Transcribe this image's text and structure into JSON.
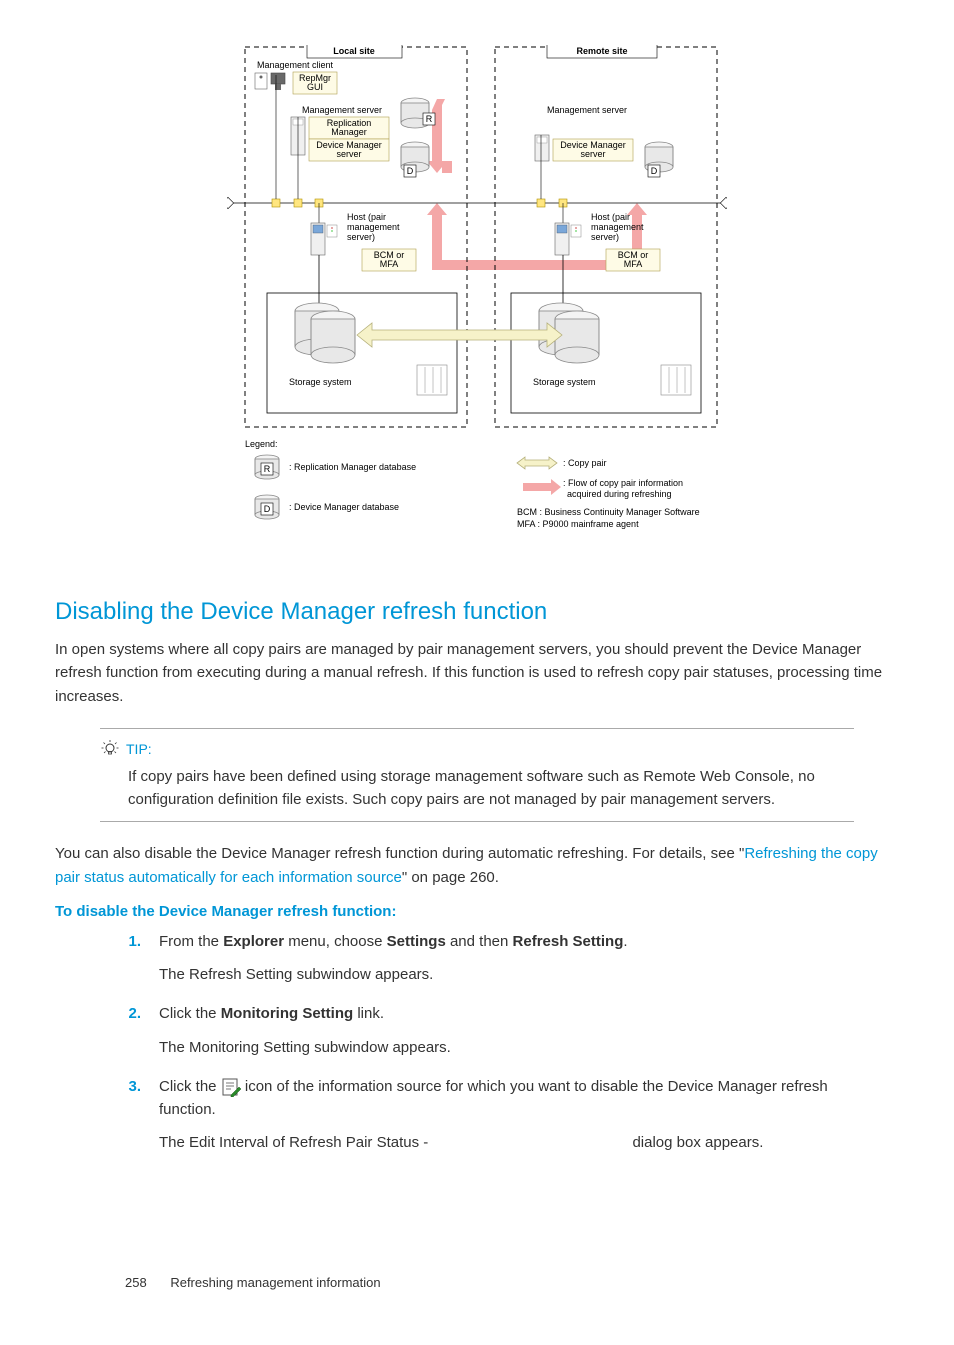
{
  "diagram": {
    "local_site": "Local site",
    "remote_site": "Remote site",
    "mgmt_client": "Management client",
    "repmgr_gui": "RepMgr GUI",
    "mgmt_server": "Management server",
    "replication_manager": "Replication Manager",
    "device_manager_server": "Device Manager server",
    "host_pair": "Host (pair management server)",
    "bcm_mfa": "BCM or MFA",
    "storage_system": "Storage system",
    "legend": "Legend:",
    "r_label": ": Replication Manager database",
    "d_label": ": Device Manager database",
    "copy_pair": ": Copy pair",
    "flow": ": Flow of copy pair information acquired during refreshing",
    "bcm_def": "BCM : Business Continuity Manager Software",
    "mfa_def": "MFA : P9000 mainframe agent",
    "r_badge": "R",
    "d_badge": "D"
  },
  "section": {
    "title": "Disabling the Device Manager refresh function",
    "intro": "In open systems where all copy pairs are managed by pair management servers, you should prevent the Device Manager refresh function from executing during a manual refresh. If this function is used to refresh copy pair statuses, processing time increases."
  },
  "tip": {
    "label": "TIP:",
    "body": "If copy pairs have been defined using storage management software such as Remote Web Console, no configuration definition file exists. Such copy pairs are not managed by pair management servers."
  },
  "para2_a": "You can also disable the Device Manager refresh function during automatic refreshing. For details, see \"",
  "para2_link": "Refreshing the copy pair status automatically for each information source",
  "para2_b": "\" on page 260.",
  "subtitle": "To disable the Device Manager refresh function:",
  "steps": {
    "n1": "1.",
    "s1a": "From the ",
    "s1b": "Explorer",
    "s1c": " menu, choose ",
    "s1d": "Settings",
    "s1e": " and then ",
    "s1f": "Refresh Setting",
    "s1g": ".",
    "s1sub": "The Refresh Setting subwindow appears.",
    "n2": "2.",
    "s2a": "Click the ",
    "s2b": "Monitoring Setting",
    "s2c": " link.",
    "s2sub": "The Monitoring Setting subwindow appears.",
    "n3": "3.",
    "s3a": "Click the ",
    "s3b": " icon of the information source for which you want to disable the Device Manager refresh function.",
    "s3sub_a": "The Edit Interval of Refresh Pair Status - ",
    "s3sub_b": " dialog box appears."
  },
  "footer": {
    "page": "258",
    "chapter": "Refreshing management information"
  }
}
